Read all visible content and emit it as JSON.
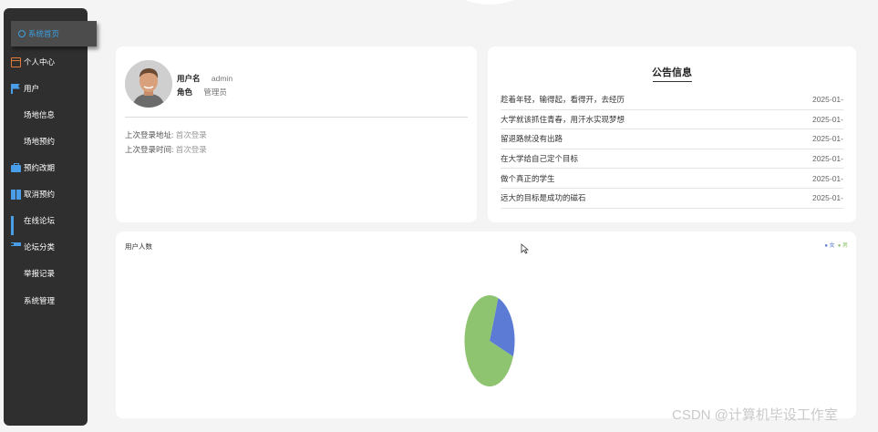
{
  "sidebar": {
    "active_item": "系统首页",
    "items": [
      {
        "label": "个人中心",
        "icon": "id-card-icon"
      },
      {
        "label": "用户",
        "icon": "flag-icon"
      },
      {
        "label": "场地信息",
        "icon": "grid-icon"
      },
      {
        "label": "场地预约",
        "icon": "grid-icon"
      },
      {
        "label": "预约改期",
        "icon": "briefcase-icon"
      },
      {
        "label": "取消预约",
        "icon": "document-icon"
      },
      {
        "label": "在线论坛",
        "icon": "bar-chart-icon"
      },
      {
        "label": "论坛分类",
        "icon": "filter-icon"
      },
      {
        "label": "举报记录",
        "icon": "grid-icon"
      },
      {
        "label": "系统管理",
        "icon": "grid-icon"
      }
    ]
  },
  "user": {
    "name_label": "用户名",
    "name_value": "admin",
    "role_label": "角色",
    "role_value": "管理员",
    "last_login_addr_label": "上次登录地址:",
    "last_login_addr_value": "首次登录",
    "last_login_time_label": "上次登录时间:",
    "last_login_time_value": "首次登录"
  },
  "notice": {
    "title": "公告信息",
    "items": [
      {
        "text": "趁着年轻，输得起，看得开，去经历",
        "date": "2025-01-"
      },
      {
        "text": "大学就该抓住青春，用汗水实现梦想",
        "date": "2025-01-"
      },
      {
        "text": "留退路就没有出路",
        "date": "2025-01-"
      },
      {
        "text": "在大学给自己定个目标",
        "date": "2025-01-"
      },
      {
        "text": "做个真正的学生",
        "date": "2025-01-"
      },
      {
        "text": "远大的目标是成功的磁石",
        "date": "2025-01-"
      }
    ]
  },
  "chart_data": {
    "type": "pie",
    "title": "用户人数",
    "legend_position": "top-right",
    "series": [
      {
        "name": "女",
        "value": 1,
        "color": "#5b7bd5"
      },
      {
        "name": "男",
        "value": 3,
        "color": "#8ec36f"
      }
    ]
  },
  "watermark": "CSDN @计算机毕设工作室"
}
